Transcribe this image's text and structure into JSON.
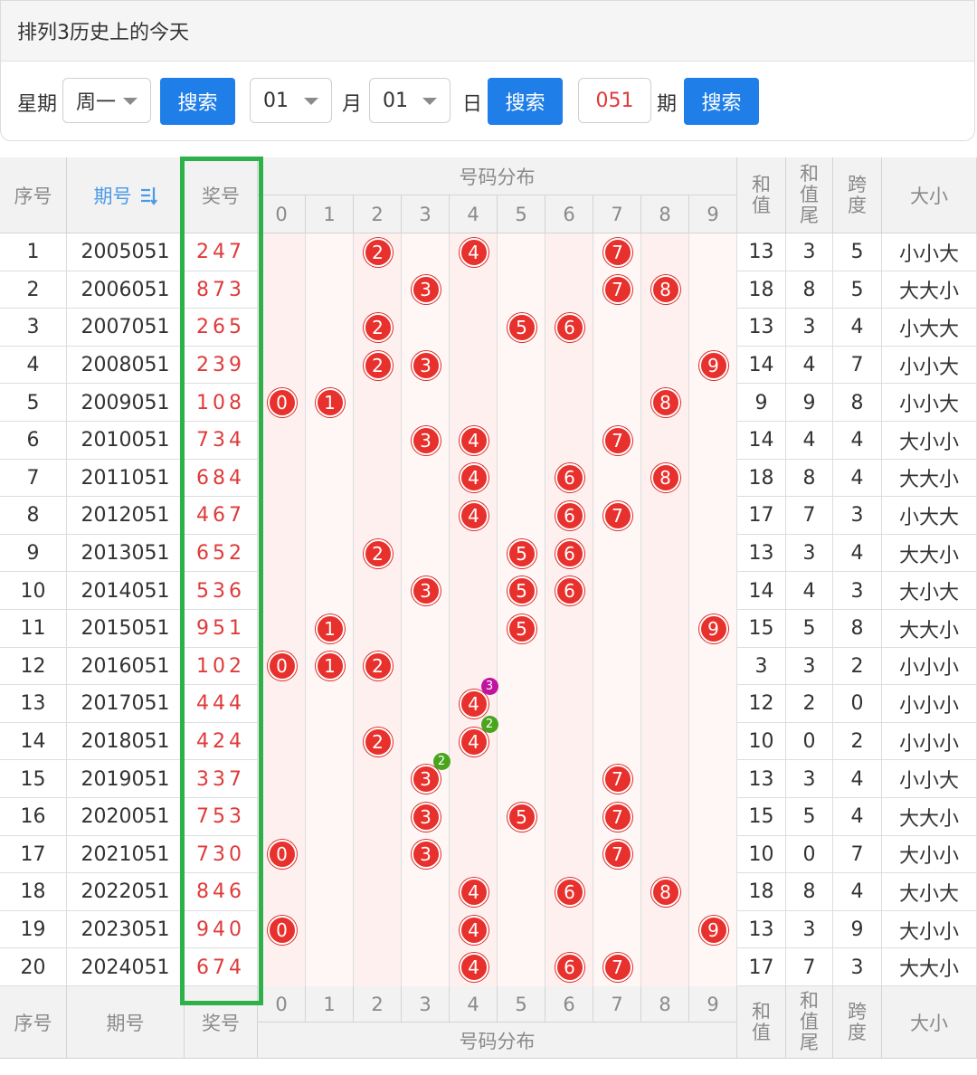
{
  "title": "排列3历史上的今天",
  "search": {
    "weekday_label": "星期",
    "weekday_value": "周一",
    "search_label": "搜索",
    "month_value": "01",
    "month_label": "月",
    "day_value": "01",
    "day_label": "日",
    "issue_value": "051",
    "issue_label": "期"
  },
  "table": {
    "headers": {
      "seq": "序号",
      "period": "期号",
      "award": "奖号",
      "dist": "号码分布",
      "sum": "和值",
      "sum_tail": "和值尾",
      "span": "跨度",
      "size": "大小"
    },
    "digits": [
      "0",
      "1",
      "2",
      "3",
      "4",
      "5",
      "6",
      "7",
      "8",
      "9"
    ],
    "rows": [
      {
        "seq": "1",
        "period": "2005051",
        "award": "247",
        "sum": "13",
        "tail": "3",
        "span": "5",
        "size": "小小大"
      },
      {
        "seq": "2",
        "period": "2006051",
        "award": "873",
        "sum": "18",
        "tail": "8",
        "span": "5",
        "size": "大大小"
      },
      {
        "seq": "3",
        "period": "2007051",
        "award": "265",
        "sum": "13",
        "tail": "3",
        "span": "4",
        "size": "小大大"
      },
      {
        "seq": "4",
        "period": "2008051",
        "award": "239",
        "sum": "14",
        "tail": "4",
        "span": "7",
        "size": "小小大"
      },
      {
        "seq": "5",
        "period": "2009051",
        "award": "108",
        "sum": "9",
        "tail": "9",
        "span": "8",
        "size": "小小大"
      },
      {
        "seq": "6",
        "period": "2010051",
        "award": "734",
        "sum": "14",
        "tail": "4",
        "span": "4",
        "size": "大小小"
      },
      {
        "seq": "7",
        "period": "2011051",
        "award": "684",
        "sum": "18",
        "tail": "8",
        "span": "4",
        "size": "大大小"
      },
      {
        "seq": "8",
        "period": "2012051",
        "award": "467",
        "sum": "17",
        "tail": "7",
        "span": "3",
        "size": "小大大"
      },
      {
        "seq": "9",
        "period": "2013051",
        "award": "652",
        "sum": "13",
        "tail": "3",
        "span": "4",
        "size": "大大小"
      },
      {
        "seq": "10",
        "period": "2014051",
        "award": "536",
        "sum": "14",
        "tail": "4",
        "span": "3",
        "size": "大小大"
      },
      {
        "seq": "11",
        "period": "2015051",
        "award": "951",
        "sum": "15",
        "tail": "5",
        "span": "8",
        "size": "大大小"
      },
      {
        "seq": "12",
        "period": "2016051",
        "award": "102",
        "sum": "3",
        "tail": "3",
        "span": "2",
        "size": "小小小"
      },
      {
        "seq": "13",
        "period": "2017051",
        "award": "444",
        "sum": "12",
        "tail": "2",
        "span": "0",
        "size": "小小小"
      },
      {
        "seq": "14",
        "period": "2018051",
        "award": "424",
        "sum": "10",
        "tail": "0",
        "span": "2",
        "size": "小小小"
      },
      {
        "seq": "15",
        "period": "2019051",
        "award": "337",
        "sum": "13",
        "tail": "3",
        "span": "4",
        "size": "小小大"
      },
      {
        "seq": "16",
        "period": "2020051",
        "award": "753",
        "sum": "15",
        "tail": "5",
        "span": "4",
        "size": "大大小"
      },
      {
        "seq": "17",
        "period": "2021051",
        "award": "730",
        "sum": "10",
        "tail": "0",
        "span": "7",
        "size": "大小小"
      },
      {
        "seq": "18",
        "period": "2022051",
        "award": "846",
        "sum": "18",
        "tail": "8",
        "span": "4",
        "size": "大小大"
      },
      {
        "seq": "19",
        "period": "2023051",
        "award": "940",
        "sum": "13",
        "tail": "3",
        "span": "9",
        "size": "大小小"
      },
      {
        "seq": "20",
        "period": "2024051",
        "award": "674",
        "sum": "17",
        "tail": "7",
        "span": "3",
        "size": "大大小"
      }
    ],
    "repeat_badges": [
      {
        "row": 13,
        "digit": "4",
        "count": "3",
        "color": "#c0169f"
      },
      {
        "row": 14,
        "digit": "4",
        "count": "2",
        "color": "#4aa51e"
      },
      {
        "row": 15,
        "digit": "3",
        "count": "2",
        "color": "#4aa51e"
      }
    ]
  },
  "colors": {
    "accent": "#1f7ee8",
    "ball": "#e8302c",
    "highlight": "#2fb14a",
    "sort_icon": "#4a9ae8"
  },
  "icons": {
    "sort": "sort-icon",
    "caret": "caret-down-icon"
  }
}
